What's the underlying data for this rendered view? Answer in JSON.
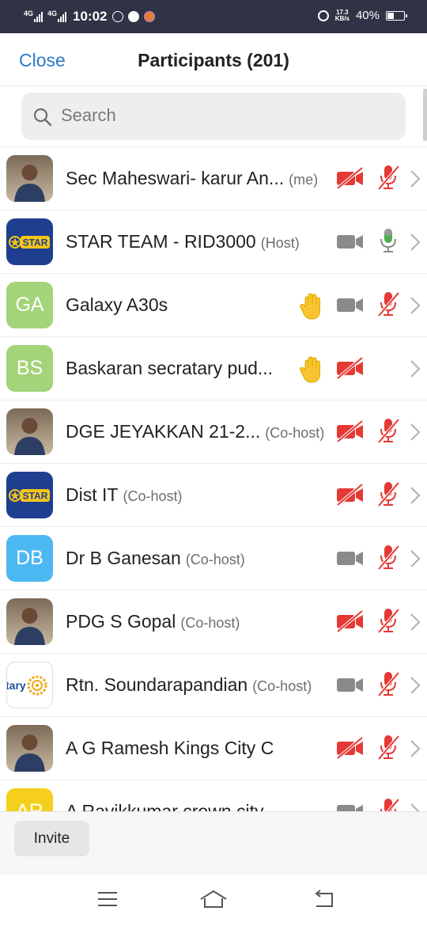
{
  "status_bar": {
    "net1": "4G",
    "net2": "4G",
    "time": "10:02",
    "speed_value": "17.3",
    "speed_unit": "KB/s",
    "battery": "40%",
    "battery_level": 0.4
  },
  "header": {
    "close_label": "Close",
    "title": "Participants (201)"
  },
  "search": {
    "placeholder": "Search"
  },
  "participants": [
    {
      "name": "Sec Maheswari- karur An...",
      "role": "(me)",
      "avatar_type": "photo",
      "avatar_icon": "person-photo",
      "hand": false,
      "video": "off",
      "mic": "muted"
    },
    {
      "name": "STAR TEAM - RID3000",
      "role": "(Host)",
      "avatar_type": "logo",
      "avatar_icon": "star-team-logo",
      "logo_text": "STAR",
      "hand": false,
      "video": "on",
      "mic": "active"
    },
    {
      "name": "Galaxy A30s",
      "role": "",
      "avatar_type": "initials",
      "initials": "GA",
      "color": "#a4d47a",
      "hand": true,
      "video": "on",
      "mic": "muted"
    },
    {
      "name": "Baskaran secratary pud...",
      "role": "",
      "avatar_type": "initials",
      "initials": "BS",
      "color": "#a4d47a",
      "hand": true,
      "video": "off",
      "mic": "none"
    },
    {
      "name": "DGE JEYAKKAN 21-2...",
      "role": "(Co-host)",
      "avatar_type": "photo",
      "avatar_icon": "person-photo",
      "hand": false,
      "video": "off",
      "mic": "muted"
    },
    {
      "name": "Dist IT",
      "role": "(Co-host)",
      "avatar_type": "logo",
      "avatar_icon": "star-team-logo",
      "logo_text": "STAR",
      "hand": false,
      "video": "off",
      "mic": "muted"
    },
    {
      "name": "Dr B Ganesan",
      "role": "(Co-host)",
      "avatar_type": "initials",
      "initials": "DB",
      "color": "#4cb8f2",
      "hand": false,
      "video": "on",
      "mic": "muted"
    },
    {
      "name": "PDG S Gopal",
      "role": "(Co-host)",
      "avatar_type": "photo",
      "avatar_icon": "person-photo",
      "hand": false,
      "video": "off",
      "mic": "muted"
    },
    {
      "name": "Rtn. Soundarapandian",
      "role": "(Co-host)",
      "avatar_type": "rotary",
      "avatar_icon": "rotary-logo",
      "logo_text": "tary",
      "hand": false,
      "video": "on",
      "mic": "muted"
    },
    {
      "name": "A G Ramesh Kings City C",
      "role": "",
      "avatar_type": "photo",
      "avatar_icon": "person-photo",
      "hand": false,
      "video": "off",
      "mic": "muted"
    },
    {
      "name": "A Ravikkumar crown city",
      "role": "",
      "avatar_type": "initials",
      "initials": "AR",
      "color": "#f5cf1c",
      "hand": false,
      "video": "on",
      "mic": "muted"
    }
  ],
  "footer": {
    "invite_label": "Invite"
  },
  "nav": {
    "menu_icon": "menu-icon",
    "home_icon": "home-icon",
    "back_icon": "back-icon"
  },
  "colors": {
    "accent": "#2a78c9",
    "muted_red": "#e53935",
    "mic_green": "#4caf50",
    "icon_gray": "#8a8a8a",
    "status_bar": "#2f3345"
  }
}
